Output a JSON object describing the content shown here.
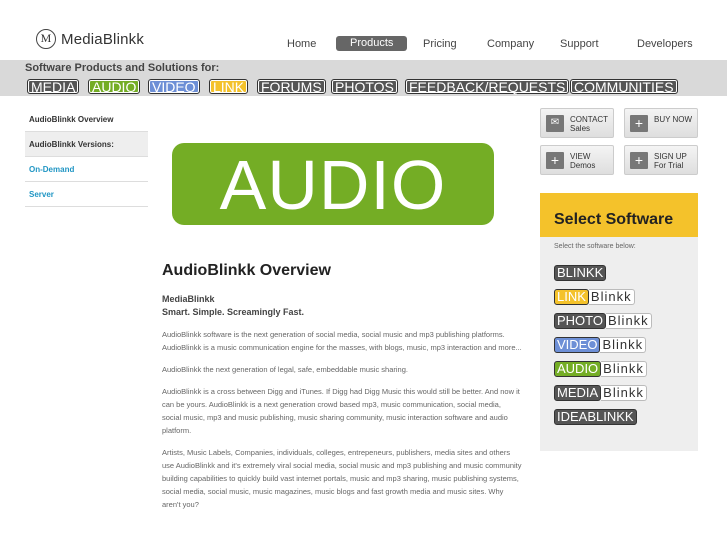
{
  "header": {
    "logo_letter": "M",
    "logo_text": "MediaBlinkk",
    "nav": [
      "Home",
      "Products",
      "Pricing",
      "Company",
      "Support",
      "Developers"
    ],
    "active_nav": "Products"
  },
  "catbar": {
    "title": "Software Products and Solutions for:",
    "items": [
      {
        "label": "MEDIA",
        "color": "#555555"
      },
      {
        "label": "AUDIO",
        "color": "#74ad25"
      },
      {
        "label": "VIDEO",
        "color": "#6d8fd6"
      },
      {
        "label": "LINK",
        "color": "#f4c22b"
      },
      {
        "label": "FORUMS",
        "color": "#555555"
      },
      {
        "label": "PHOTOS",
        "color": "#555555"
      },
      {
        "label": "FEEDBACK/REQUESTS",
        "color": "#555555"
      },
      {
        "label": "COMMUNITIES",
        "color": "#555555"
      }
    ]
  },
  "sidebar": {
    "items": [
      {
        "label": "AudioBlinkk Overview"
      },
      {
        "label": "AudioBlinkk Versions:"
      },
      {
        "label": "On-Demand"
      },
      {
        "label": "Server"
      }
    ]
  },
  "hero": {
    "text": "AUDIO",
    "color": "#74ad25"
  },
  "main": {
    "title": "AudioBlinkk Overview",
    "company": "MediaBlinkk",
    "tagline": "Smart. Simple. Screamingly Fast.",
    "paragraphs": [
      "AudioBlinkk software is the next generation of social media, social music and mp3 publishing platforms. AudioBlinkk is a music communication engine for the masses, with blogs, music, mp3 interaction and more...",
      "AudioBlinkk the next generation of legal, safe, embeddable music sharing.",
      "AudioBlinkk is a cross between Digg and iTunes. If Digg had Digg Music this would still be better. And now it can be yours. AudioBlinkk is a next generation crowd based mp3, music communication, social media, social music, mp3 and music publishing, music sharing community, music interaction software and audio platform.",
      "Artists, Music Labels, Companies, individuals, colleges, entrepeneurs, publishers, media sites and others use AudioBlinkk and it's extremely viral social media, social music and mp3 publishing and music community building capabilities to quickly build vast internet portals, music and mp3 sharing, music publishing systems, social media, social music, music magazines, music blogs and fast growth media and music sites. Why aren't you?"
    ]
  },
  "buttons": {
    "contact": {
      "line1": "CONTACT",
      "line2": "Sales",
      "icon": "mail-icon"
    },
    "buy": {
      "line1": "BUY NOW",
      "line2": "",
      "icon": "plus-icon"
    },
    "view": {
      "line1": "VIEW",
      "line2": "Demos",
      "icon": "plus-icon"
    },
    "signup": {
      "line1": "SIGN UP",
      "line2": "For Trial",
      "icon": "plus-icon"
    }
  },
  "select_software": {
    "title": "Select Software",
    "hint": "Select the software below:",
    "items": [
      {
        "a": "BLINKK",
        "b": "",
        "color": "#555555"
      },
      {
        "a": "LINK",
        "b": "Blinkk",
        "color": "#f4c22b"
      },
      {
        "a": "PHOTO",
        "b": "Blinkk",
        "color": "#555555"
      },
      {
        "a": "VIDEO",
        "b": "Blinkk",
        "color": "#6d8fd6"
      },
      {
        "a": "AUDIO",
        "b": "Blinkk",
        "color": "#74ad25"
      },
      {
        "a": "MEDIA",
        "b": "Blinkk",
        "color": "#555555"
      },
      {
        "a": "IDEABLINKK",
        "b": "",
        "color": "#555555"
      }
    ]
  }
}
